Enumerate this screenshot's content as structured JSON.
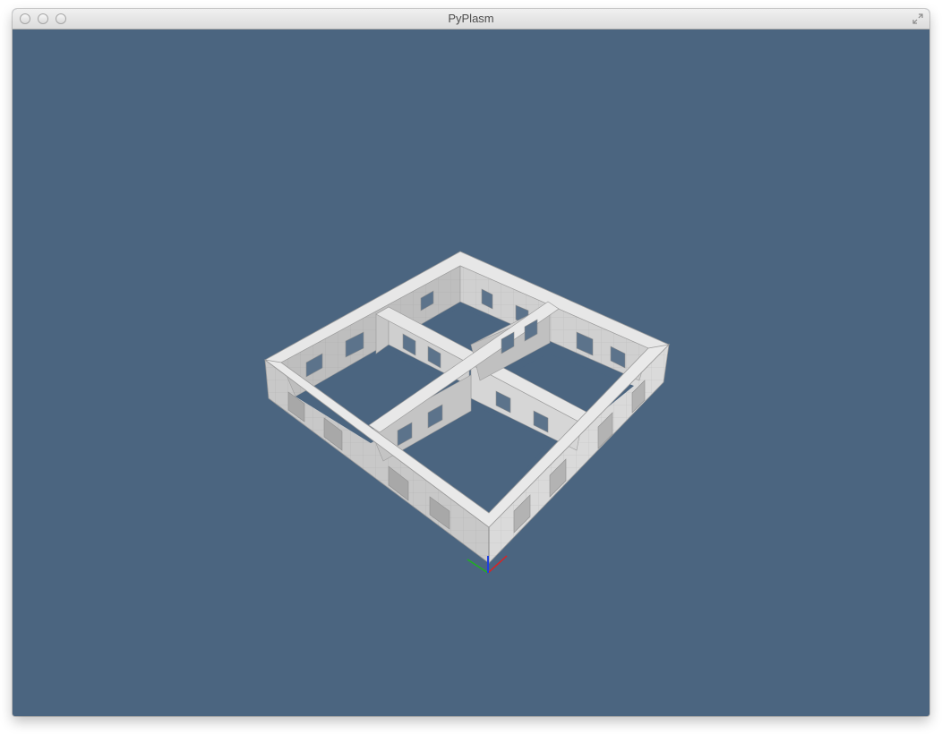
{
  "window": {
    "title": "PyPlasm"
  },
  "colors": {
    "viewport_background": "#4b6580",
    "wall_top": "#e4e4e4",
    "wall_light": "#d9d9d9",
    "wall_mid": "#c4c4c4",
    "wall_dark": "#a9a9a9",
    "axis_x": "#e02020",
    "axis_y": "#20b020",
    "axis_z": "#2040e0"
  },
  "icons": {
    "close": "close-icon",
    "minimize": "minimize-icon",
    "zoom": "zoom-icon",
    "fullscreen": "fullscreen-arrows-icon"
  }
}
